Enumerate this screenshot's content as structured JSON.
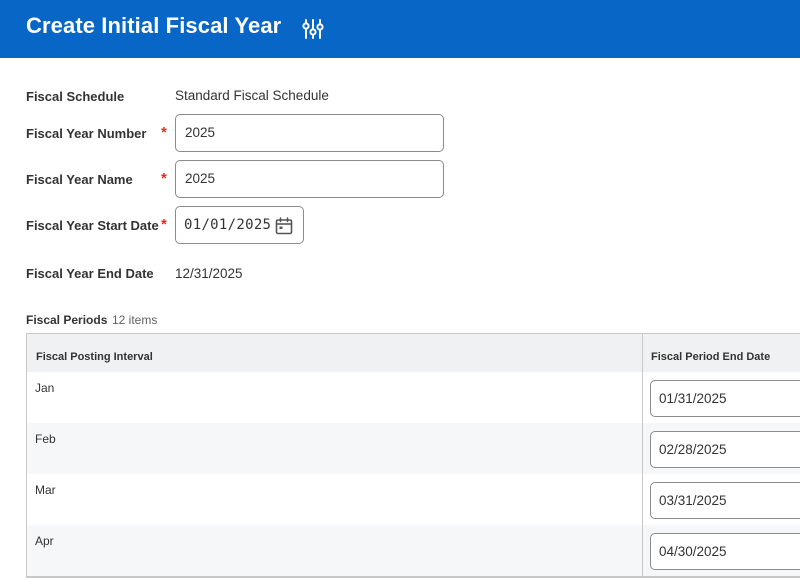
{
  "header": {
    "title": "Create Initial Fiscal Year",
    "icon": "related-actions-icon",
    "background": "#0866c6"
  },
  "form": {
    "fiscal_schedule": {
      "label": "Fiscal Schedule",
      "value": "Standard Fiscal Schedule"
    },
    "fiscal_year_number": {
      "label": "Fiscal Year Number",
      "value": "2025",
      "required": "*"
    },
    "fiscal_year_name": {
      "label": "Fiscal Year Name",
      "value": "2025",
      "required": "*"
    },
    "fiscal_year_start_date": {
      "label": "Fiscal Year Start Date",
      "value": "01/01/2025",
      "required": "*",
      "icon": "calendar-icon"
    },
    "fiscal_year_end_date": {
      "label": "Fiscal Year End Date",
      "value": "12/31/2025"
    }
  },
  "fiscal_periods": {
    "title": "Fiscal Periods",
    "count": "12 items",
    "columns": [
      "Fiscal Posting Interval",
      "Fiscal Period End Date"
    ],
    "rows": [
      {
        "interval": "Jan",
        "end_date": "01/31/2025"
      },
      {
        "interval": "Feb",
        "end_date": "02/28/2025"
      },
      {
        "interval": "Mar",
        "end_date": "03/31/2025"
      },
      {
        "interval": "Apr",
        "end_date": "04/30/2025"
      }
    ]
  },
  "colors": {
    "required": "#de2e21",
    "border": "#8b8b8b"
  }
}
